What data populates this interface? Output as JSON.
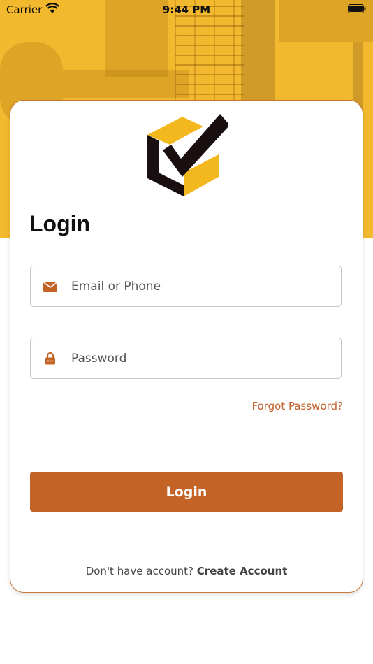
{
  "status_bar": {
    "carrier": "Carrier",
    "time": "9:44 PM"
  },
  "login": {
    "title": "Login",
    "email_placeholder": "Email or Phone",
    "password_placeholder": "Password",
    "forgot_password": "Forgot Password?",
    "login_button": "Login",
    "no_account_text": "Don't have account?",
    "create_account": "Create Account"
  },
  "colors": {
    "accent": "#c36325",
    "header_yellow": "#f2b82e",
    "logo_yellow": "#f4b81f",
    "logo_dark": "#1a0f10",
    "card_border": "#c8783a"
  },
  "icons": {
    "email_field": "envelope-icon",
    "password_field": "lock-icon",
    "logo": "checkmark-box-logo"
  }
}
